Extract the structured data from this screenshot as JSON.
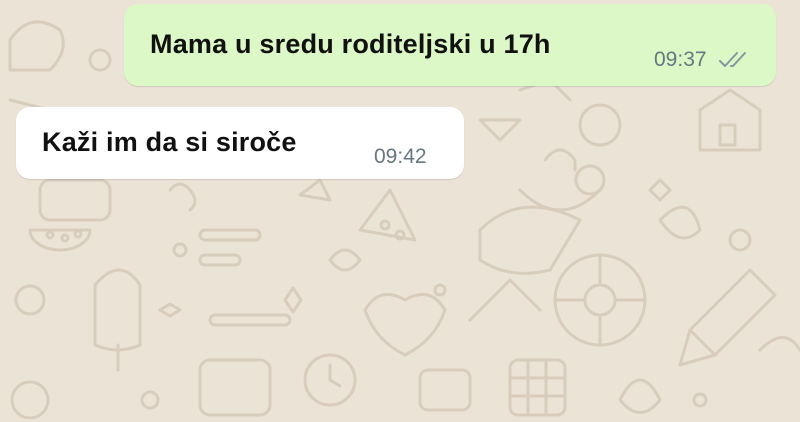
{
  "chat": {
    "messages": [
      {
        "direction": "outgoing",
        "text": "Mama u sredu roditeljski u 17h",
        "time": "09:37",
        "status_icon": "double-check-icon"
      },
      {
        "direction": "incoming",
        "text": "Kaži im da si siroče",
        "time": "09:42"
      }
    ]
  },
  "colors": {
    "wallpaper": "#ece3d7",
    "doodle": "#d8cdbc",
    "outgoing_bubble": "#dcf8c6",
    "incoming_bubble": "#ffffff",
    "meta_text": "#667781"
  }
}
